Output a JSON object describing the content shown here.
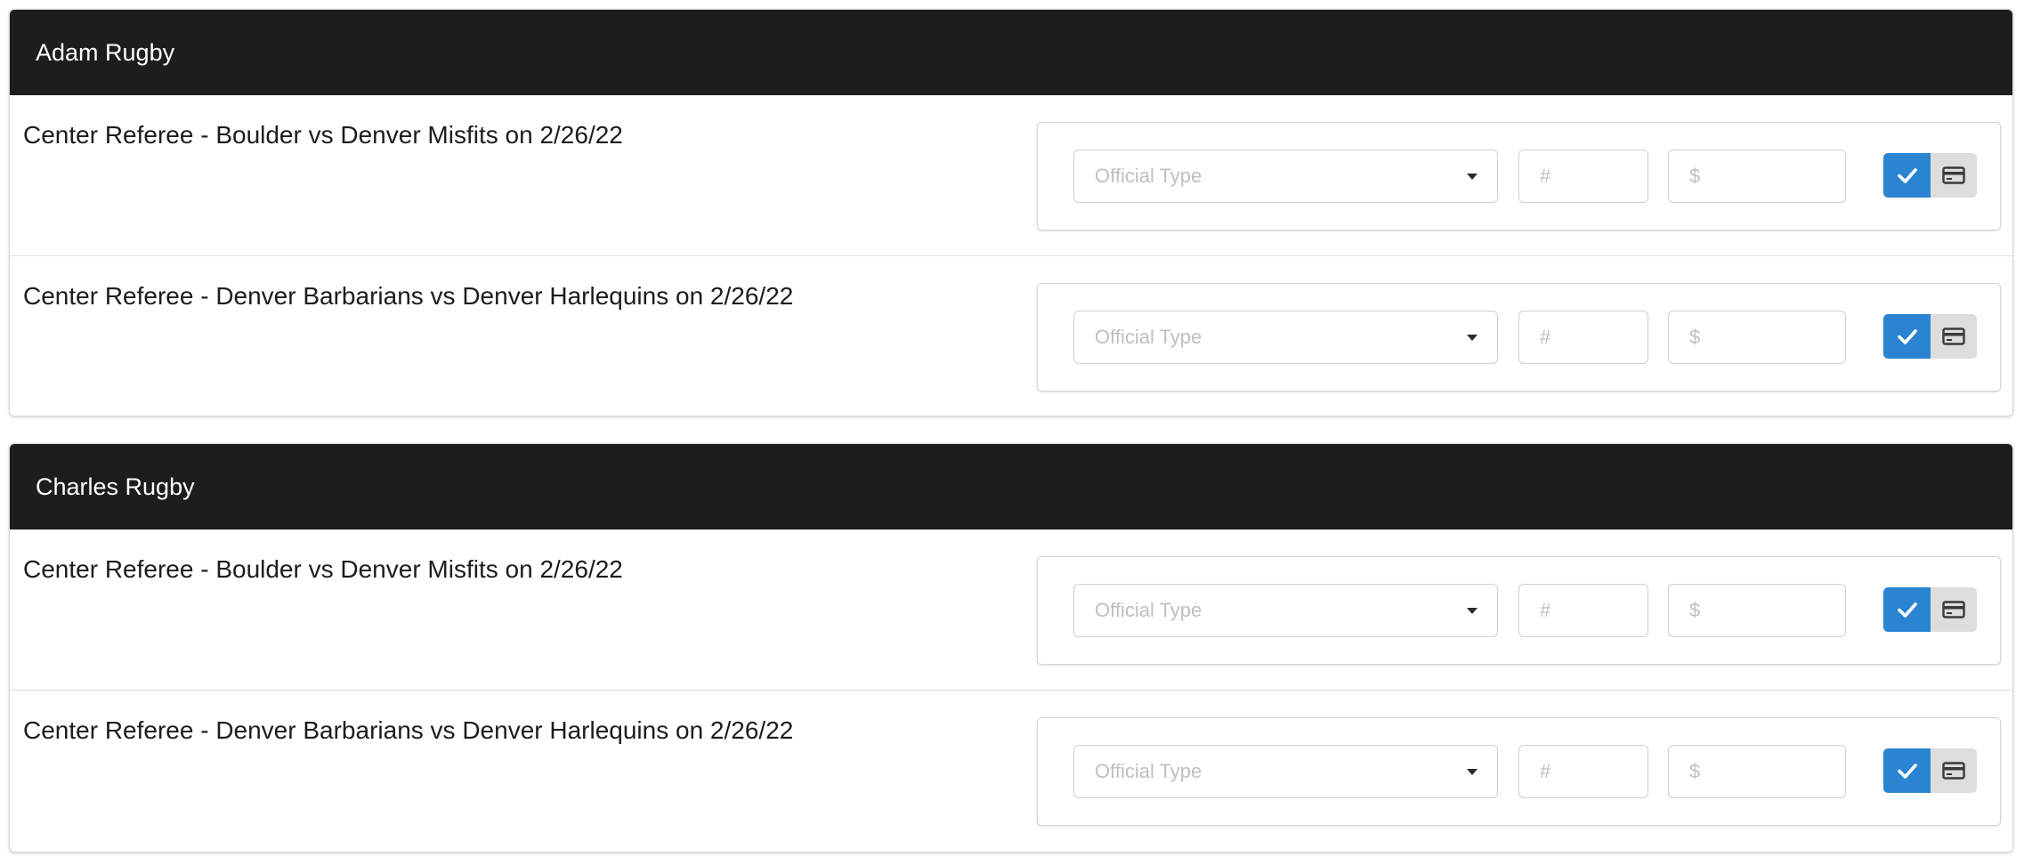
{
  "groups": [
    {
      "title": "Adam Rugby",
      "rows": [
        {
          "label": "Center Referee - Boulder vs Denver Misfits on 2/26/22"
        },
        {
          "label": "Center Referee - Denver Barbarians vs Denver Harlequins on 2/26/22"
        }
      ]
    },
    {
      "title": "Charles Rugby",
      "rows": [
        {
          "label": "Center Referee - Boulder vs Denver Misfits on 2/26/22"
        },
        {
          "label": "Center Referee - Denver Barbarians vs Denver Harlequins on 2/26/22"
        }
      ]
    }
  ],
  "form": {
    "official_type_placeholder": "Official Type",
    "number_placeholder": "#",
    "amount_placeholder": "$"
  },
  "icons": {
    "confirm": "check-icon",
    "payment": "credit-card-icon"
  },
  "colors": {
    "header_bg": "#1c1d1f",
    "confirm_button": "#2b84d2",
    "payment_button": "#dddde0"
  }
}
